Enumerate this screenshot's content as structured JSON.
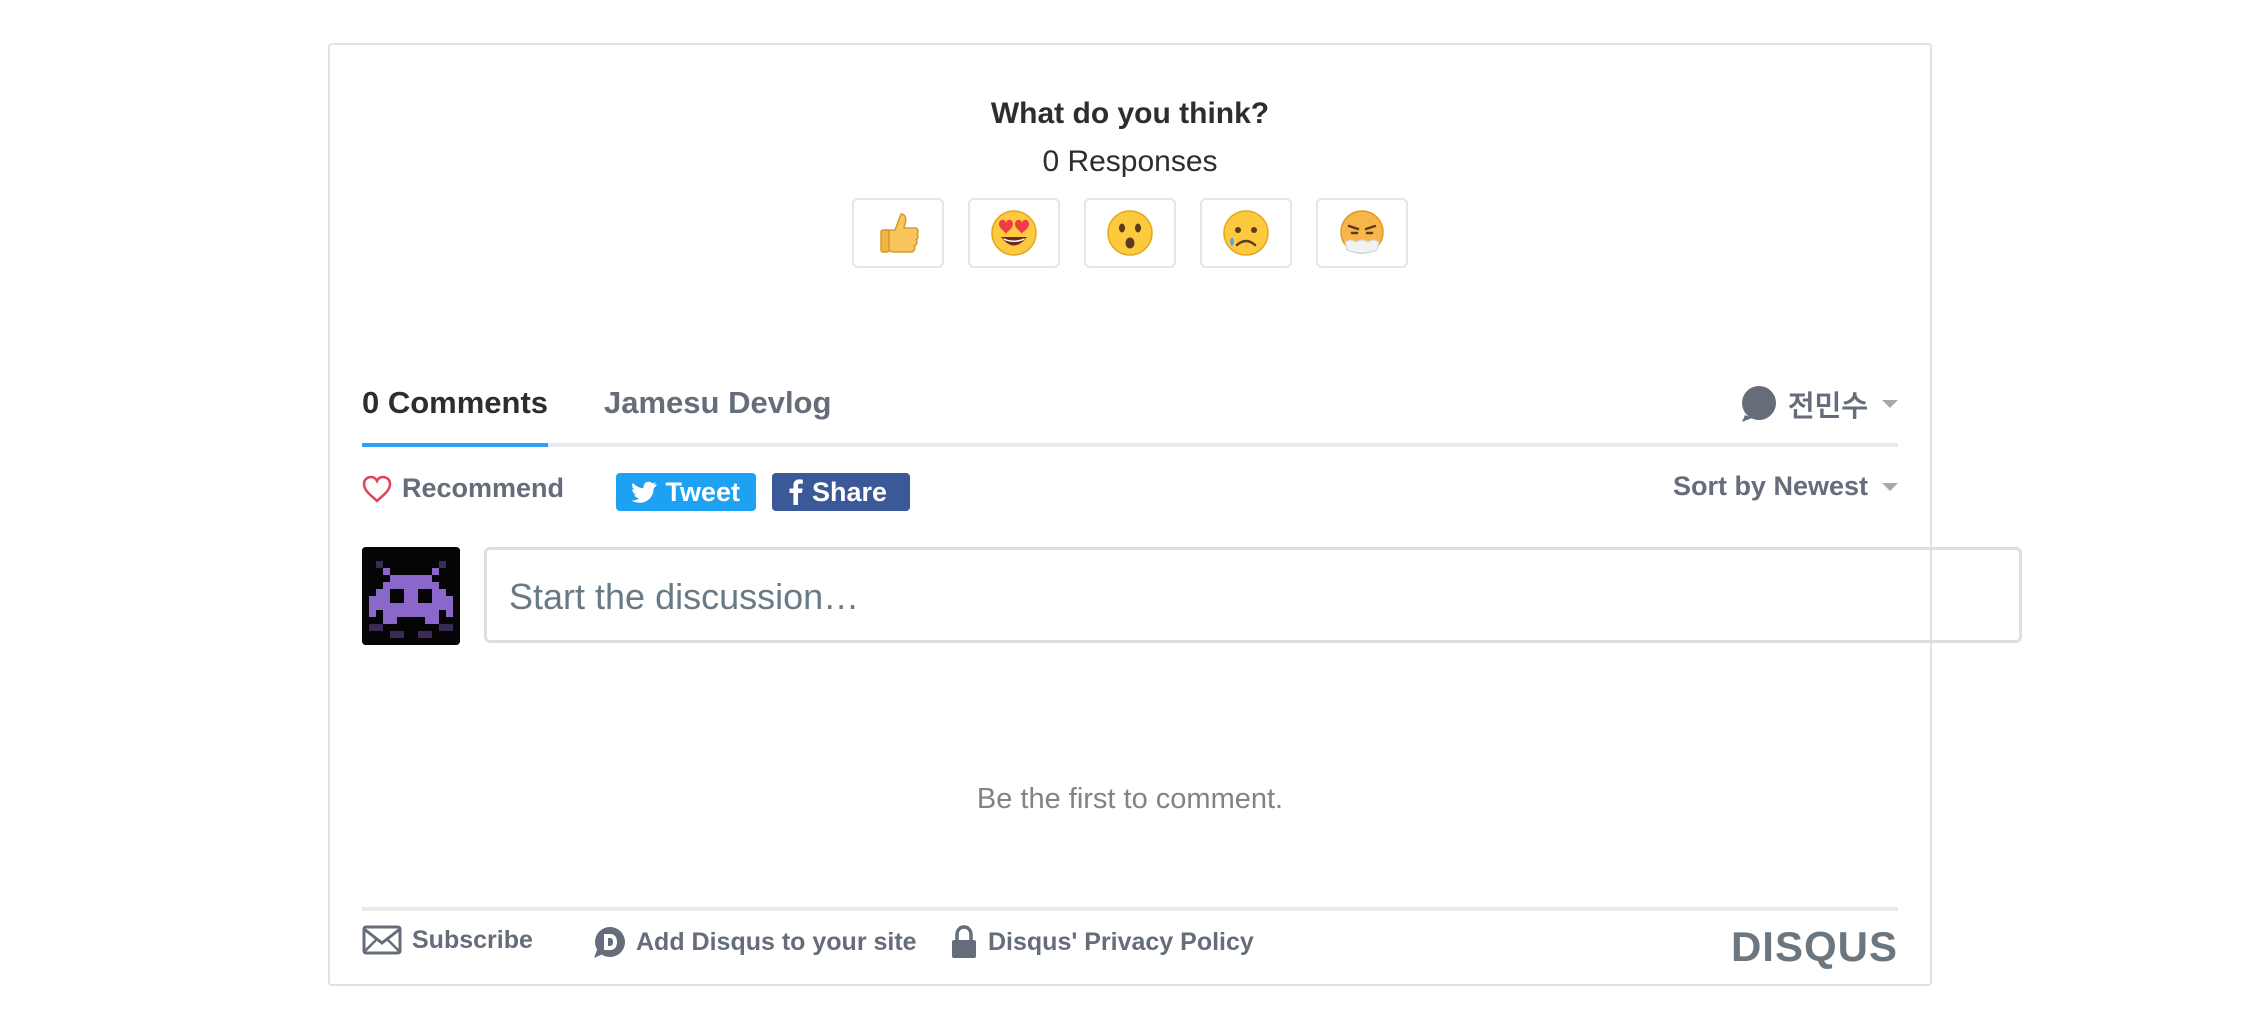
{
  "reactions": {
    "title": "What do you think?",
    "count_label": "0 Responses",
    "items": [
      {
        "icon": "thumbs-up"
      },
      {
        "icon": "heart-eyes"
      },
      {
        "icon": "surprised"
      },
      {
        "icon": "sad"
      },
      {
        "icon": "angry"
      }
    ]
  },
  "tabs": {
    "comments_label": "0 Comments",
    "community_label": "Jamesu Devlog",
    "user_name": "전민수"
  },
  "actions": {
    "recommend_label": "Recommend",
    "tweet_label": "Tweet",
    "share_label": "Share",
    "sort_label": "Sort by Newest"
  },
  "composer": {
    "placeholder": "Start the discussion…"
  },
  "empty_message": "Be the first to comment.",
  "footer": {
    "subscribe_label": "Subscribe",
    "add_disqus_label": "Add Disqus to your site",
    "privacy_label": "Disqus' Privacy Policy",
    "logo_text": "DISQUS"
  },
  "colors": {
    "accent": "#2e9fff",
    "twitter": "#1da1f2",
    "facebook": "#3b5998",
    "muted_text": "#656c7a"
  }
}
